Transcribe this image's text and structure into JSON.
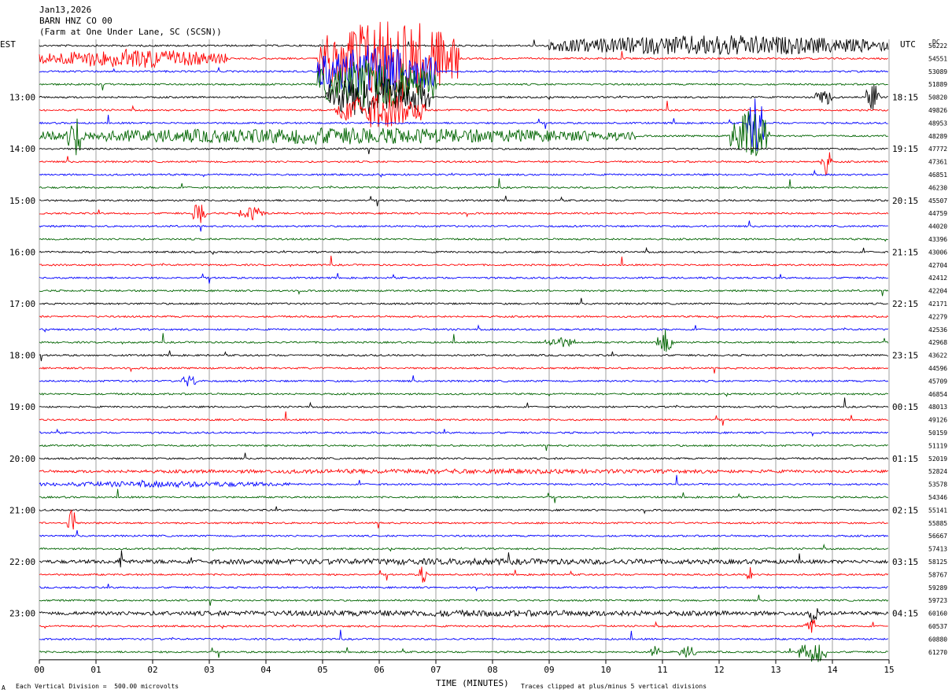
{
  "header": {
    "date": "Jan13,2026",
    "station": "BARN HNZ CO 00",
    "location": "(Farm at One Under Lane, SC (SCSN))"
  },
  "left_timezone": "EST",
  "right_timezone": "UTC",
  "dc_label": "DC",
  "footer": {
    "scale_note": "Each Vertical Division =  500.00 microvolts",
    "clip_note": "Traces clipped at plus/minus 5 vertical divisions",
    "corner_mark": "A"
  },
  "chart_data": {
    "type": "line",
    "title": "",
    "xlabel": "TIME (MINUTES)",
    "ylabel": "",
    "xlim": [
      0,
      15
    ],
    "x_ticks": [
      "00",
      "01",
      "02",
      "03",
      "04",
      "05",
      "06",
      "07",
      "08",
      "09",
      "10",
      "11",
      "12",
      "13",
      "14",
      "15"
    ],
    "series_colors": [
      "#000000",
      "#ff0000",
      "#0000ff",
      "#006400"
    ],
    "left_hour_labels": [
      "13:00",
      "14:00",
      "15:00",
      "16:00",
      "17:00",
      "18:00",
      "19:00",
      "20:00",
      "21:00",
      "22:00",
      "23:00"
    ],
    "right_hour_labels": [
      "18:15",
      "19:15",
      "20:15",
      "21:15",
      "22:15",
      "23:15",
      "00:15",
      "01:15",
      "02:15",
      "03:15",
      "04:15"
    ],
    "hour_label_trace_start": 4,
    "dc_offsets": [
      56222,
      54551,
      53089,
      51889,
      50820,
      49826,
      48953,
      48289,
      47772,
      47361,
      46851,
      46230,
      45507,
      44759,
      44020,
      43396,
      43006,
      42704,
      42412,
      42204,
      42171,
      42279,
      42536,
      42968,
      43622,
      44596,
      45709,
      46854,
      48013,
      49126,
      50159,
      51119,
      52019,
      52824,
      53578,
      54346,
      55141,
      55885,
      56667,
      57413,
      58125,
      58767,
      59289,
      59723,
      60160,
      60537,
      60880,
      61270
    ],
    "events": [
      {
        "trace": 0,
        "start_min": 9.0,
        "end_min": 15.0,
        "amplitude": 14
      },
      {
        "trace": 1,
        "start_min": 0.0,
        "end_min": 3.3,
        "amplitude": 13
      },
      {
        "trace": 1,
        "start_min": 4.9,
        "end_min": 7.4,
        "amplitude": 60
      },
      {
        "trace": 2,
        "start_min": 4.9,
        "end_min": 7.0,
        "amplitude": 36
      },
      {
        "trace": 3,
        "start_min": 4.9,
        "end_min": 7.0,
        "amplitude": 36
      },
      {
        "trace": 4,
        "start_min": 5.0,
        "end_min": 6.9,
        "amplitude": 30
      },
      {
        "trace": 5,
        "start_min": 5.2,
        "end_min": 6.8,
        "amplitude": 24
      },
      {
        "trace": 4,
        "start_min": 13.7,
        "end_min": 14.0,
        "amplitude": 12
      },
      {
        "trace": 4,
        "start_min": 14.6,
        "end_min": 14.85,
        "amplitude": 18
      },
      {
        "trace": 7,
        "start_min": 0.0,
        "end_min": 10.5,
        "amplitude": 11
      },
      {
        "trace": 7,
        "start_min": 0.5,
        "end_min": 0.8,
        "amplitude": 26
      },
      {
        "trace": 7,
        "start_min": 12.2,
        "end_min": 12.9,
        "amplitude": 34
      },
      {
        "trace": 6,
        "start_min": 12.5,
        "end_min": 12.8,
        "amplitude": 40
      },
      {
        "trace": 9,
        "start_min": 13.8,
        "end_min": 14.0,
        "amplitude": 18
      },
      {
        "trace": 13,
        "start_min": 2.7,
        "end_min": 2.95,
        "amplitude": 16
      },
      {
        "trace": 13,
        "start_min": 3.5,
        "end_min": 4.0,
        "amplitude": 9
      },
      {
        "trace": 23,
        "start_min": 10.9,
        "end_min": 11.2,
        "amplitude": 17
      },
      {
        "trace": 23,
        "start_min": 8.9,
        "end_min": 9.5,
        "amplitude": 7
      },
      {
        "trace": 26,
        "start_min": 2.5,
        "end_min": 2.8,
        "amplitude": 8
      },
      {
        "trace": 37,
        "start_min": 0.5,
        "end_min": 0.65,
        "amplitude": 22
      },
      {
        "trace": 40,
        "start_min": 1.4,
        "end_min": 1.5,
        "amplitude": 16
      },
      {
        "trace": 41,
        "start_min": 6.7,
        "end_min": 6.85,
        "amplitude": 14
      },
      {
        "trace": 41,
        "start_min": 12.5,
        "end_min": 12.6,
        "amplitude": 14
      },
      {
        "trace": 44,
        "start_min": 13.6,
        "end_min": 13.75,
        "amplitude": 18
      },
      {
        "trace": 45,
        "start_min": 13.5,
        "end_min": 13.7,
        "amplitude": 14
      },
      {
        "trace": 47,
        "start_min": 13.4,
        "end_min": 13.9,
        "amplitude": 16
      },
      {
        "trace": 47,
        "start_min": 11.3,
        "end_min": 11.6,
        "amplitude": 8
      },
      {
        "trace": 47,
        "start_min": 10.8,
        "end_min": 10.95,
        "amplitude": 8
      },
      {
        "trace": 40,
        "start_min": 0.0,
        "end_min": 15.0,
        "amplitude": 4
      },
      {
        "trace": 44,
        "start_min": 0.0,
        "end_min": 15.0,
        "amplitude": 4
      },
      {
        "trace": 33,
        "start_min": 0.0,
        "end_min": 15.0,
        "amplitude": 3
      },
      {
        "trace": 34,
        "start_min": 0.0,
        "end_min": 4.5,
        "amplitude": 4
      }
    ]
  }
}
